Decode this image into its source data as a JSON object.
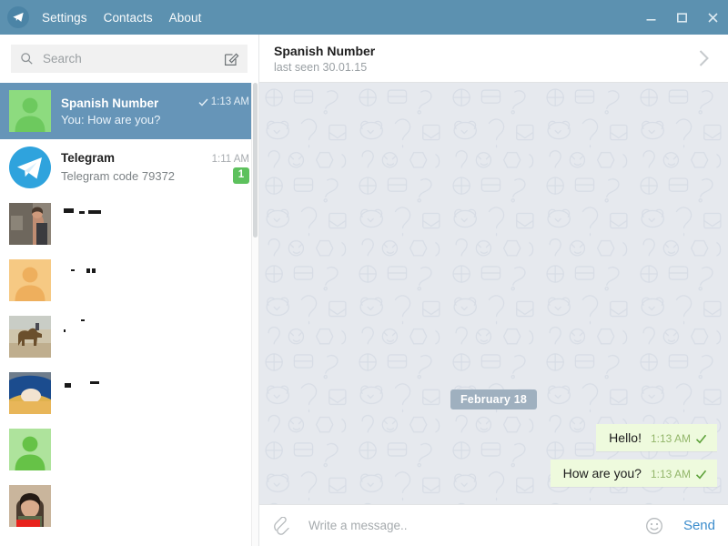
{
  "titlebar": {
    "logo_icon": "telegram-plane-icon",
    "menu": [
      {
        "label": "Settings"
      },
      {
        "label": "Contacts"
      },
      {
        "label": "About"
      }
    ],
    "window_controls": [
      {
        "name": "minimize",
        "icon": "minimize-icon"
      },
      {
        "name": "maximize",
        "icon": "maximize-icon"
      },
      {
        "name": "close",
        "icon": "close-icon"
      }
    ],
    "bg_color": "#5c91b0"
  },
  "sidebar": {
    "search": {
      "placeholder": "Search",
      "value": "",
      "icon": "search-icon",
      "compose_icon": "compose-pencil-icon"
    },
    "chats": [
      {
        "name": "Spanish Number",
        "preview": "You: How are you?",
        "time": "1:13 AM",
        "checked": true,
        "selected": true,
        "badge": "",
        "avatar_type": "placeholder-green",
        "redacted": false
      },
      {
        "name": "Telegram",
        "preview": "Telegram code 79372",
        "time": "1:11 AM",
        "checked": false,
        "selected": false,
        "badge": "1",
        "avatar_type": "telegram-logo",
        "redacted": false
      },
      {
        "name": "",
        "preview": "",
        "time": "",
        "checked": false,
        "selected": false,
        "badge": "",
        "avatar_type": "photo-person-wall",
        "redacted": true
      },
      {
        "name": "",
        "preview": "",
        "time": "",
        "checked": false,
        "selected": false,
        "badge": "",
        "avatar_type": "placeholder-orange",
        "redacted": true
      },
      {
        "name": "",
        "preview": "",
        "time": "",
        "checked": false,
        "selected": false,
        "badge": "",
        "avatar_type": "photo-camel",
        "redacted": true
      },
      {
        "name": "",
        "preview": "",
        "time": "",
        "checked": false,
        "selected": false,
        "badge": "",
        "avatar_type": "photo-beach",
        "redacted": true
      },
      {
        "name": "",
        "preview": "",
        "time": "",
        "checked": false,
        "selected": false,
        "badge": "",
        "avatar_type": "placeholder-green",
        "redacted": true
      },
      {
        "name": "",
        "preview": "",
        "time": "",
        "checked": false,
        "selected": false,
        "badge": "",
        "avatar_type": "photo-woman",
        "redacted": true
      }
    ],
    "selected_bg": "#6695b8",
    "badge_color": "#5dc15d"
  },
  "chat_header": {
    "title": "Spanish Number",
    "subtitle": "last seen 30.01.15",
    "arrow_icon": "chevron-right-icon"
  },
  "conversation": {
    "date_separator": "February 18",
    "messages": [
      {
        "text": "Hello!",
        "time": "1:13 AM",
        "outgoing": true,
        "status_icon": "check-icon"
      },
      {
        "text": "How are you?",
        "time": "1:13 AM",
        "outgoing": true,
        "status_icon": "check-icon"
      }
    ],
    "bubble_color": "#eefadd",
    "date_pill_color": "#9fb0bf"
  },
  "composer": {
    "attach_icon": "paperclip-icon",
    "placeholder": "Write a message..",
    "value": "",
    "emoji_icon": "smiley-icon",
    "send_label": "Send",
    "send_color": "#3b8ccc"
  }
}
